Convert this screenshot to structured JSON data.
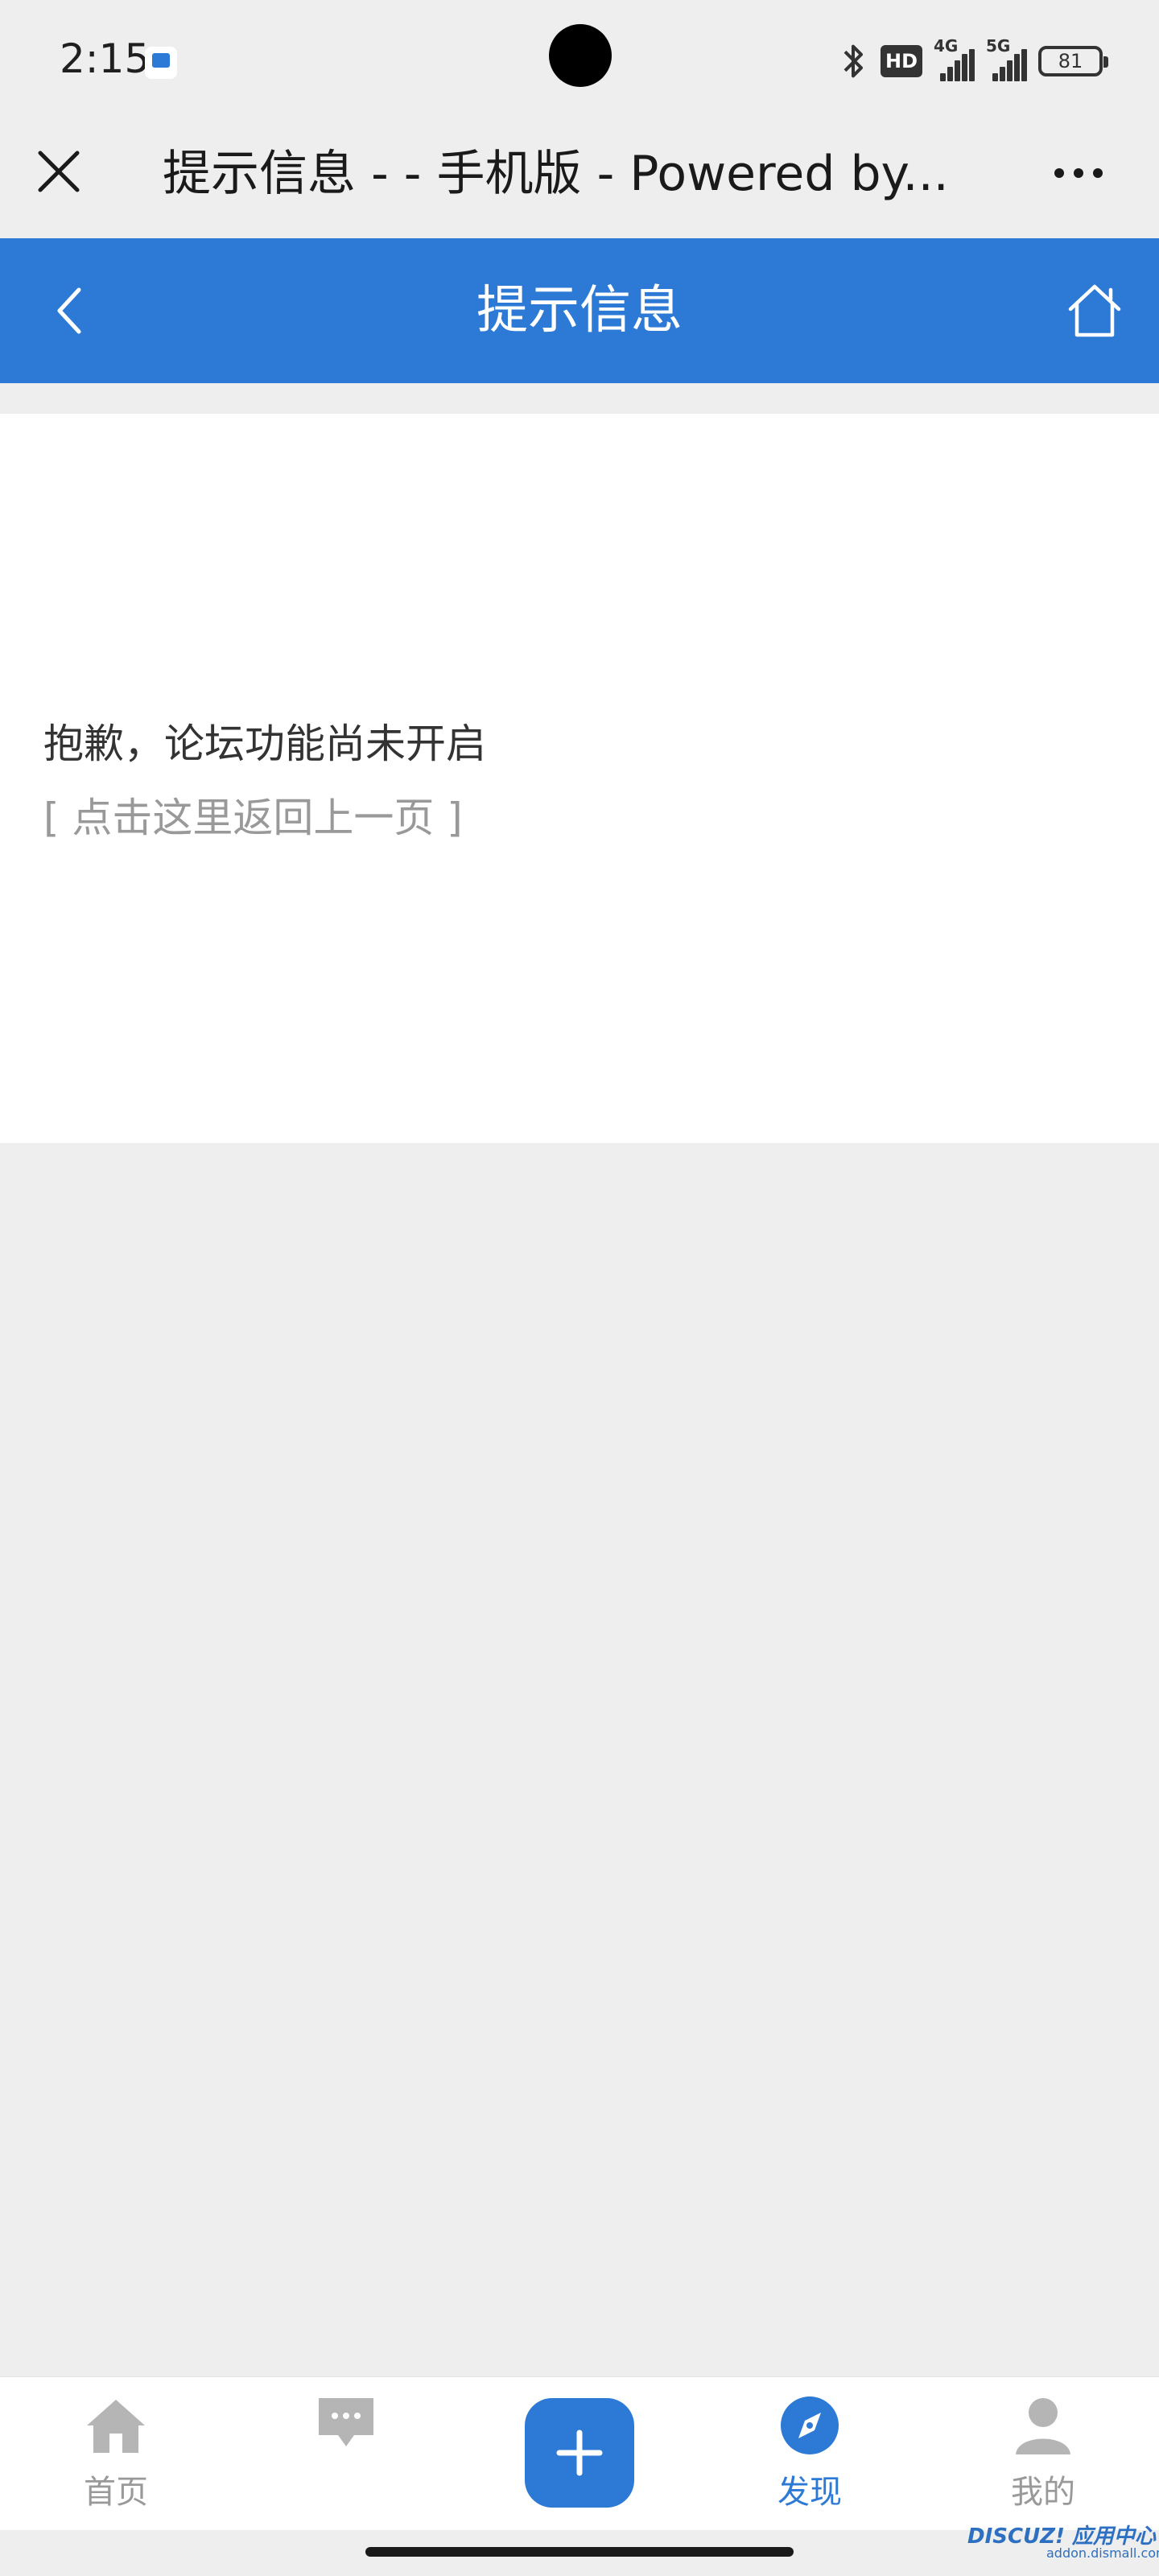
{
  "status_bar": {
    "time": "2:15",
    "hd_label": "HD",
    "net1_label": "4G",
    "net2_label": "5G",
    "battery": "81"
  },
  "browser": {
    "page_title": "提示信息 - - 手机版 - Powered by..."
  },
  "header": {
    "title": "提示信息"
  },
  "content": {
    "message": "抱歉，论坛功能尚未开启",
    "back_link": "[ 点击这里返回上一页 ]"
  },
  "bottom_nav": {
    "items": [
      {
        "label": "首页",
        "icon": "home-icon"
      },
      {
        "label": "",
        "icon": "chat-icon"
      },
      {
        "label": "",
        "icon": "plus-icon"
      },
      {
        "label": "发现",
        "icon": "compass-icon",
        "active": true
      },
      {
        "label": "我的",
        "icon": "user-icon"
      }
    ]
  },
  "watermark": {
    "brand": "DISCUZ! 应用中心",
    "site": "addon.dismall.com"
  },
  "colors": {
    "accent": "#2d7ad6",
    "background": "#eeeeee",
    "muted_text": "#999999"
  }
}
